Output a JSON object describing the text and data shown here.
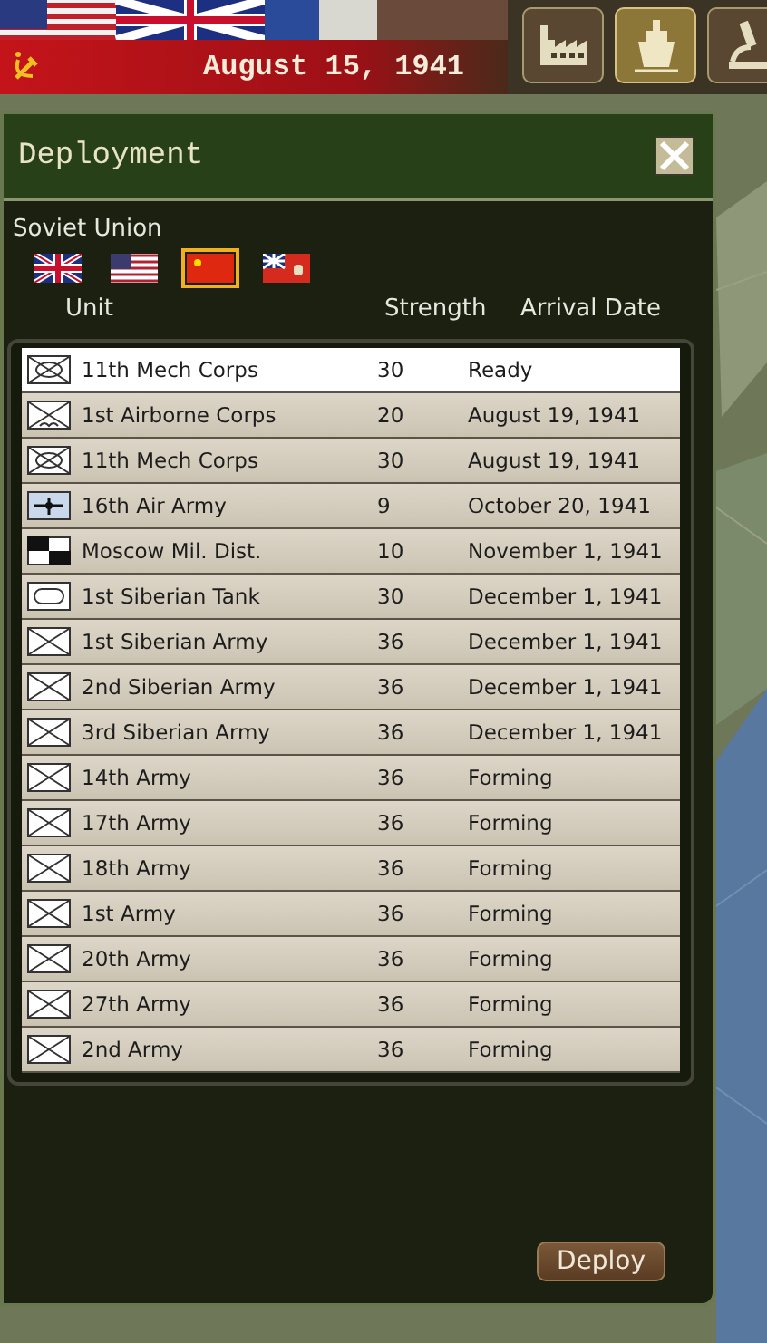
{
  "top_bar": {
    "date": "August 15, 1941",
    "tools": [
      {
        "kind": "factory",
        "selected": false
      },
      {
        "kind": "ship",
        "selected": true
      },
      {
        "kind": "microscope",
        "selected": false
      }
    ]
  },
  "panel": {
    "title": "Deployment",
    "nation": "Soviet Union",
    "flags": [
      {
        "kind": "uk",
        "selected": false
      },
      {
        "kind": "us",
        "selected": false
      },
      {
        "kind": "china",
        "selected": true
      },
      {
        "kind": "ensign",
        "selected": false
      }
    ],
    "columns": [
      "Unit",
      "Strength",
      "Arrival Date"
    ],
    "rows": [
      {
        "kind": "mech",
        "unit": "11th Mech Corps",
        "strength": "30",
        "arrival": "Ready",
        "selected": true
      },
      {
        "kind": "airborne",
        "unit": "1st Airborne Corps",
        "strength": "20",
        "arrival": "August 19, 1941",
        "selected": false
      },
      {
        "kind": "mech",
        "unit": "11th Mech Corps",
        "strength": "30",
        "arrival": "August 19, 1941",
        "selected": false
      },
      {
        "kind": "air",
        "unit": "16th Air Army",
        "strength": "9",
        "arrival": "October 20, 1941",
        "selected": false
      },
      {
        "kind": "hq",
        "unit": "Moscow Mil. Dist.",
        "strength": "10",
        "arrival": "November 1, 1941",
        "selected": false
      },
      {
        "kind": "armor",
        "unit": "1st Siberian Tank",
        "strength": "30",
        "arrival": "December 1, 1941",
        "selected": false
      },
      {
        "kind": "infantry",
        "unit": "1st Siberian Army",
        "strength": "36",
        "arrival": "December 1, 1941",
        "selected": false
      },
      {
        "kind": "infantry",
        "unit": "2nd Siberian Army",
        "strength": "36",
        "arrival": "December 1, 1941",
        "selected": false
      },
      {
        "kind": "infantry",
        "unit": "3rd Siberian Army",
        "strength": "36",
        "arrival": "December 1, 1941",
        "selected": false
      },
      {
        "kind": "infantry",
        "unit": "14th Army",
        "strength": "36",
        "arrival": "Forming",
        "selected": false
      },
      {
        "kind": "infantry",
        "unit": "17th Army",
        "strength": "36",
        "arrival": "Forming",
        "selected": false
      },
      {
        "kind": "infantry",
        "unit": "18th Army",
        "strength": "36",
        "arrival": "Forming",
        "selected": false
      },
      {
        "kind": "infantry",
        "unit": "1st Army",
        "strength": "36",
        "arrival": "Forming",
        "selected": false
      },
      {
        "kind": "infantry",
        "unit": "20th Army",
        "strength": "36",
        "arrival": "Forming",
        "selected": false
      },
      {
        "kind": "infantry",
        "unit": "27th Army",
        "strength": "36",
        "arrival": "Forming",
        "selected": false
      },
      {
        "kind": "infantry",
        "unit": "2nd Army",
        "strength": "36",
        "arrival": "Forming",
        "selected": false
      }
    ],
    "button": "Deploy"
  }
}
